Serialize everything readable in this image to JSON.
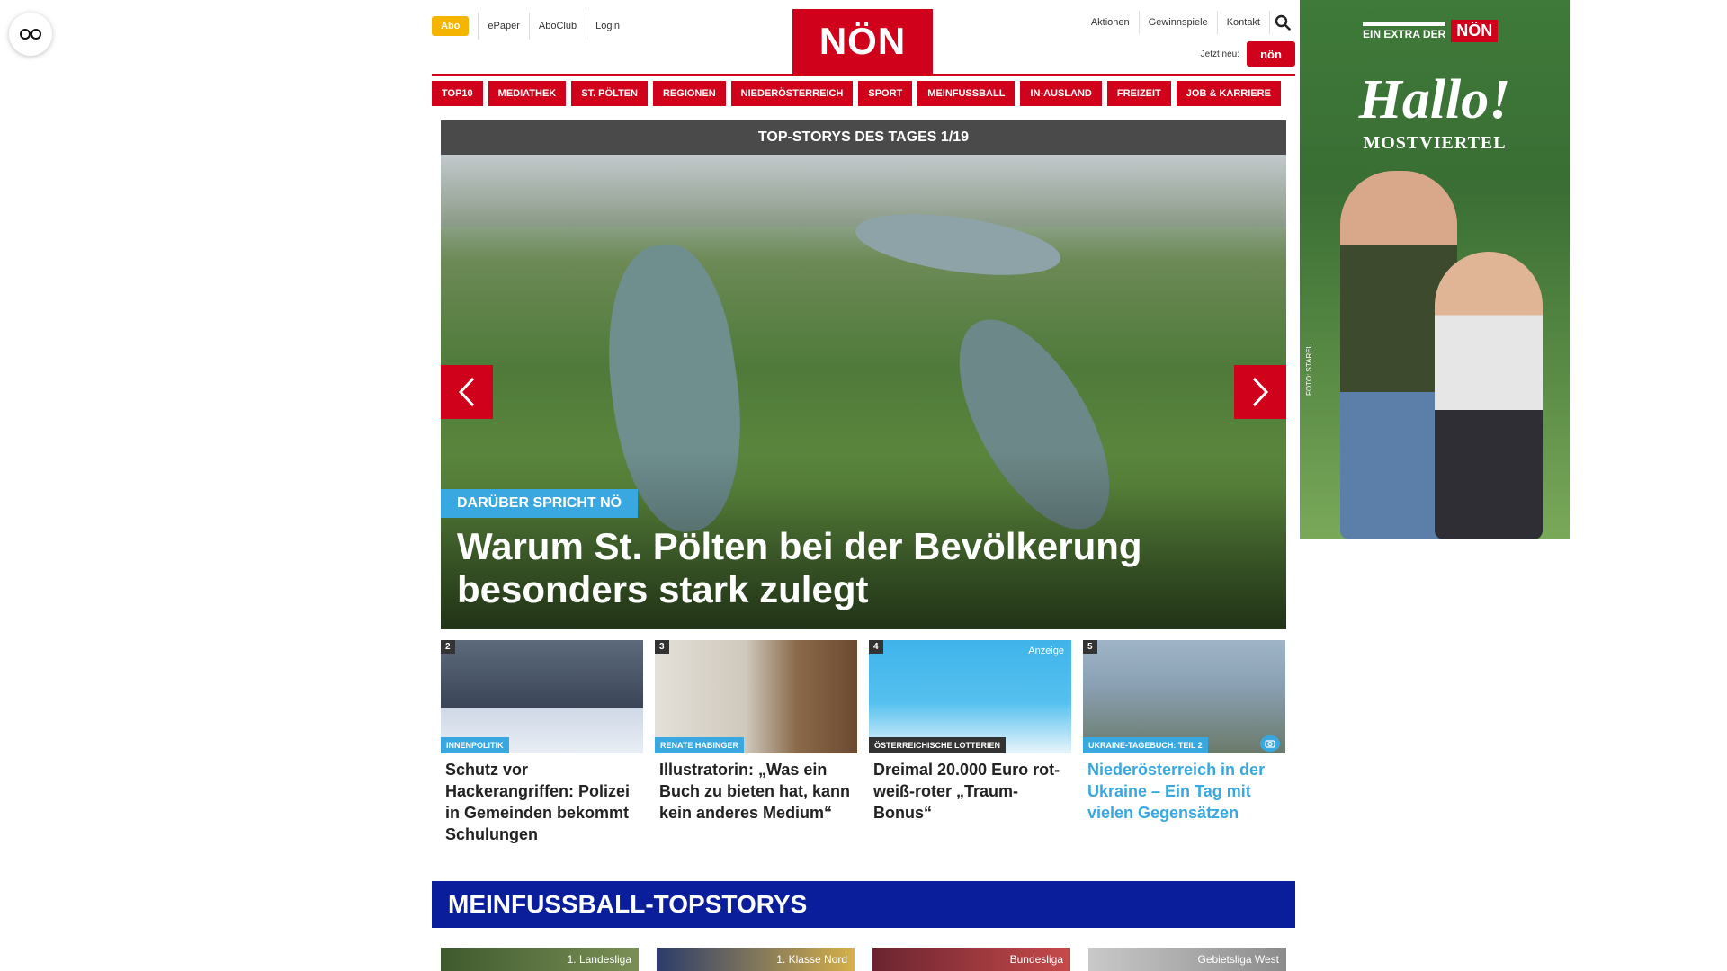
{
  "colors": {
    "brand_red": "#d0021b",
    "accent_blue": "#3aa8e0",
    "section_blue": "#0a1e9c",
    "abo_yellow": "#f5b400"
  },
  "header": {
    "abo_label": "Abo",
    "left_links": [
      "ePaper",
      "AboClub",
      "Login"
    ],
    "logo_text": "NÖN",
    "right_links": [
      "Aktionen",
      "Gewinnspiele",
      "Kontakt"
    ],
    "jetzt_neu_label": "Jetzt neu:",
    "jetzt_neu_badge": "nön"
  },
  "main_nav": [
    "TOP10",
    "MEDIATHEK",
    "ST. PÖLTEN",
    "REGIONEN",
    "NIEDERÖSTERREICH",
    "SPORT",
    "MEINFUSSBALL",
    "IN-AUSLAND",
    "FREIZEIT",
    "JOB & KARRIERE"
  ],
  "top_stories": {
    "header": "TOP-STORYS DES TAGES 1/19",
    "hero": {
      "tag": "DARÜBER SPRICHT NÖ",
      "title": "Warum St. Pölten bei der Bevölkerung besonders stark zulegt"
    },
    "cards": [
      {
        "number": "2",
        "category": "INNENPOLITIK",
        "title": "Schutz vor Hackerangriffen: Polizei in Gemeinden bekommt Schulungen"
      },
      {
        "number": "3",
        "category": "RENATE HABINGER",
        "title": "Illustratorin: „Was ein Buch zu bieten hat, kann kein anderes Medium“"
      },
      {
        "number": "4",
        "badge": "Anzeige",
        "category": "ÖSTERREICHISCHE LOTTERIEN",
        "title": "Dreimal 20.000 Euro rot-weiß-roter „Traum-Bonus“"
      },
      {
        "number": "5",
        "category": "UKRAINE-TAGEBUCH: TEIL 2",
        "title": "Niederösterreich in der Ukraine – Ein Tag mit vielen Gegensätzen"
      }
    ]
  },
  "section": {
    "title": "MEINFUSSBALL-TOPSTORYS",
    "cards": [
      "1. Landesliga",
      "1. Klasse Nord",
      "Bundesliga",
      "Gebietsliga West"
    ]
  },
  "ad": {
    "extra_text": "EIN EXTRA DER",
    "extra_logo": "NÖN",
    "headline": "Hallo!",
    "subline": "MOSTVIERTEL",
    "credit": "FOTO: STAREL"
  }
}
